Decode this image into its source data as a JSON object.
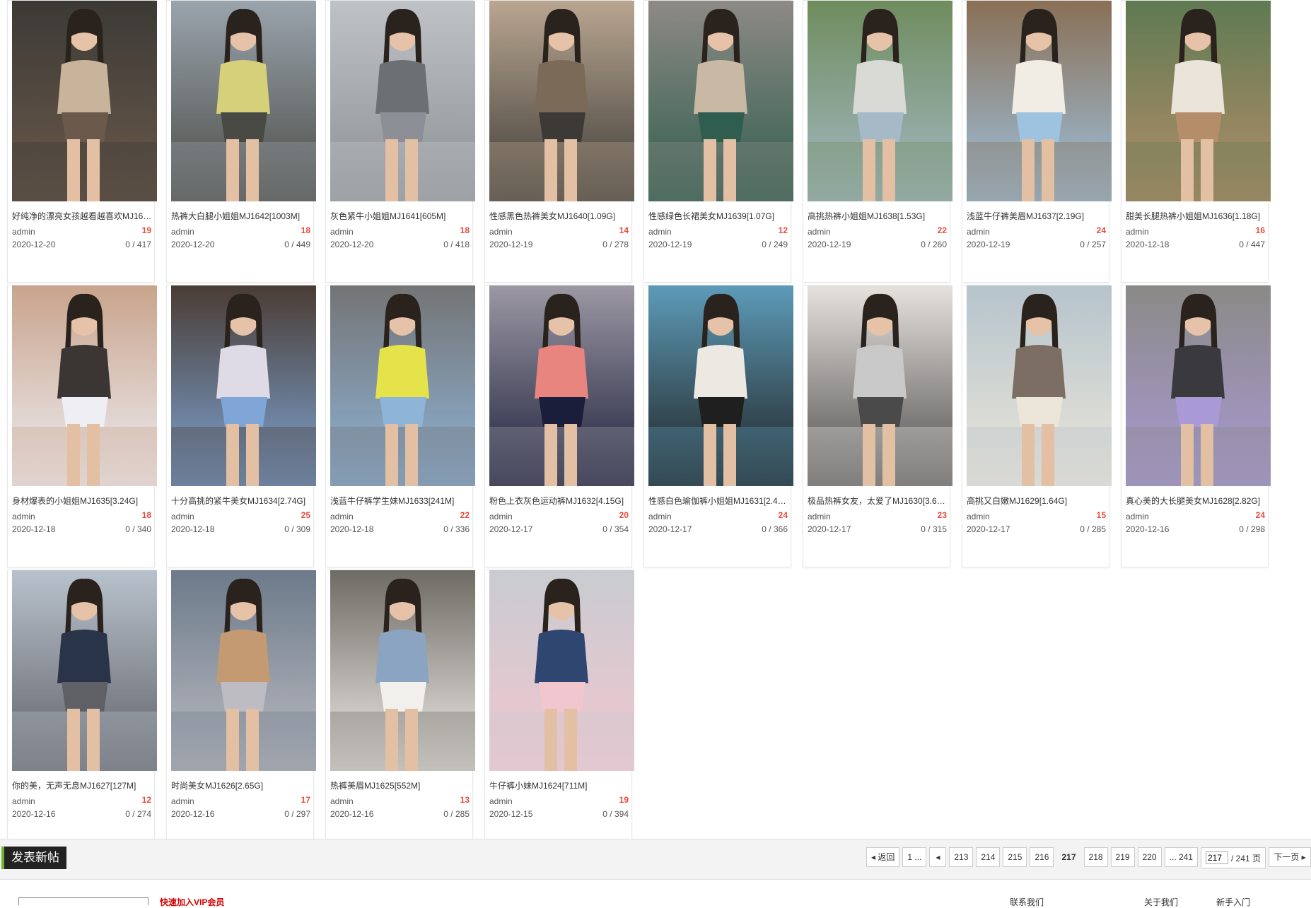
{
  "posts": [
    {
      "title": "好纯净的漂亮女孩越看越喜欢MJ164…",
      "author": "admin",
      "likes": "19",
      "date": "2020-12-20",
      "stats": "0 / 417",
      "palette": [
        "#6b5a4c",
        "#c8b49a",
        "#3c3a36"
      ]
    },
    {
      "title": "热裤大白腿小姐姐MJ1642[1003M]",
      "author": "admin",
      "likes": "18",
      "date": "2020-12-20",
      "stats": "0 / 449",
      "palette": [
        "#4a4a44",
        "#d6d07a",
        "#9aa4ad"
      ]
    },
    {
      "title": "灰色紧牛小姐姐MJ1641[605M]",
      "author": "admin",
      "likes": "18",
      "date": "2020-12-20",
      "stats": "0 / 418",
      "palette": [
        "#8c9096",
        "#6c6f74",
        "#bfc2c5"
      ]
    },
    {
      "title": "性感黑色热裤美女MJ1640[1.09G]",
      "author": "admin",
      "likes": "14",
      "date": "2020-12-19",
      "stats": "0 / 278",
      "palette": [
        "#3b3a36",
        "#7b6a58",
        "#b9a690"
      ]
    },
    {
      "title": "性感绿色长裙美女MJ1639[1.07G]",
      "author": "admin",
      "likes": "12",
      "date": "2020-12-19",
      "stats": "0 / 249",
      "palette": [
        "#2f5d4f",
        "#c9b8a4",
        "#8d8a84"
      ]
    },
    {
      "title": "高挑热裤小姐姐MJ1638[1.53G]",
      "author": "admin",
      "likes": "22",
      "date": "2020-12-19",
      "stats": "0 / 260",
      "palette": [
        "#a5b9c7",
        "#d9d9d6",
        "#6f8c5d"
      ]
    },
    {
      "title": "浅蓝牛仔裤美眉MJ1637[2.19G]",
      "author": "admin",
      "likes": "24",
      "date": "2020-12-19",
      "stats": "0 / 257",
      "palette": [
        "#9ec3e0",
        "#f1ede4",
        "#8a6f55"
      ]
    },
    {
      "title": "甜美长腿热裤小姐姐MJ1636[1.18G]",
      "author": "admin",
      "likes": "16",
      "date": "2020-12-18",
      "stats": "0 / 447",
      "palette": [
        "#b48e6a",
        "#eae4da",
        "#5f7a52"
      ]
    },
    {
      "title": "身材爆表的小姐姐MJ1635[3.24G]",
      "author": "admin",
      "likes": "18",
      "date": "2020-12-18",
      "stats": "0 / 340",
      "palette": [
        "#eeeef4",
        "#3b3633",
        "#c9a48c"
      ]
    },
    {
      "title": "十分高挑的紧牛美女MJ1634[2.74G]",
      "author": "admin",
      "likes": "25",
      "date": "2020-12-18",
      "stats": "0 / 309",
      "palette": [
        "#7fa6d6",
        "#dedbe6",
        "#4a3c34"
      ]
    },
    {
      "title": "浅蓝牛仔裤学生妹MJ1633[241M]",
      "author": "admin",
      "likes": "22",
      "date": "2020-12-18",
      "stats": "0 / 336",
      "palette": [
        "#8eb4d8",
        "#e6e24a",
        "#747474"
      ]
    },
    {
      "title": "粉色上衣灰色运动裤MJ1632[4.15G]",
      "author": "admin",
      "likes": "20",
      "date": "2020-12-17",
      "stats": "0 / 354",
      "palette": [
        "#1b1e3a",
        "#e8857e",
        "#9c98a4"
      ]
    },
    {
      "title": "性感白色瑜伽裤小姐姐MJ1631[2.45…",
      "author": "admin",
      "likes": "24",
      "date": "2020-12-17",
      "stats": "0 / 366",
      "palette": [
        "#1f1f1f",
        "#ece9e2",
        "#5d9bb8"
      ]
    },
    {
      "title": "极品热裤女友，太爱了MJ1630[3.61…",
      "author": "admin",
      "likes": "23",
      "date": "2020-12-17",
      "stats": "0 / 315",
      "palette": [
        "#4a4a4a",
        "#c9c9c9",
        "#e6e2de"
      ]
    },
    {
      "title": "高挑又白嫩MJ1629[1.64G]",
      "author": "admin",
      "likes": "15",
      "date": "2020-12-17",
      "stats": "0 / 285",
      "palette": [
        "#ece6da",
        "#7c6e62",
        "#b6c4cc"
      ]
    },
    {
      "title": "真心美的大长腿美女MJ1628[2.82G]",
      "author": "admin",
      "likes": "24",
      "date": "2020-12-16",
      "stats": "0 / 298",
      "palette": [
        "#a99ad6",
        "#3a3a3e",
        "#8a8a86"
      ]
    },
    {
      "title": "你的美，无声无息MJ1627[127M]",
      "author": "admin",
      "likes": "12",
      "date": "2020-12-16",
      "stats": "0 / 274",
      "palette": [
        "#5f5f66",
        "#2a3448",
        "#b8c2cc"
      ]
    },
    {
      "title": "时尚美女MJ1626[2.65G]",
      "author": "admin",
      "likes": "17",
      "date": "2020-12-16",
      "stats": "0 / 297",
      "palette": [
        "#bdbcc2",
        "#c49a72",
        "#6c7a8a"
      ]
    },
    {
      "title": "热裤美眉MJ1625[552M]",
      "author": "admin",
      "likes": "13",
      "date": "2020-12-16",
      "stats": "0 / 285",
      "palette": [
        "#f2f0ec",
        "#8ba4c2",
        "#6e6a64"
      ]
    },
    {
      "title": "牛仔裤小妹MJ1624[711M]",
      "author": "admin",
      "likes": "19",
      "date": "2020-12-15",
      "stats": "0 / 394",
      "palette": [
        "#f2c6cf",
        "#2f4670",
        "#c8ccd0"
      ]
    }
  ],
  "toolbar": {
    "new_post_label": "发表新帖"
  },
  "pagination": {
    "back_label": "返回",
    "first_label": "1 ...",
    "prev_icon": "chevron-left-icon",
    "pages": [
      "213",
      "214",
      "215",
      "216",
      "217",
      "218",
      "219",
      "220"
    ],
    "current_page": "217",
    "last_label": "... 241",
    "jump_value": "217",
    "jump_suffix": "/ 241 页",
    "next_label": "下一页"
  },
  "footer": {
    "red_text": "快速加入VIP会员",
    "links": [
      "联系我们",
      "关于我们",
      "新手入门"
    ]
  },
  "colors": {
    "accent_green": "#6fb22f",
    "like_red": "#e74c3c",
    "post_button_bg": "#222222"
  }
}
